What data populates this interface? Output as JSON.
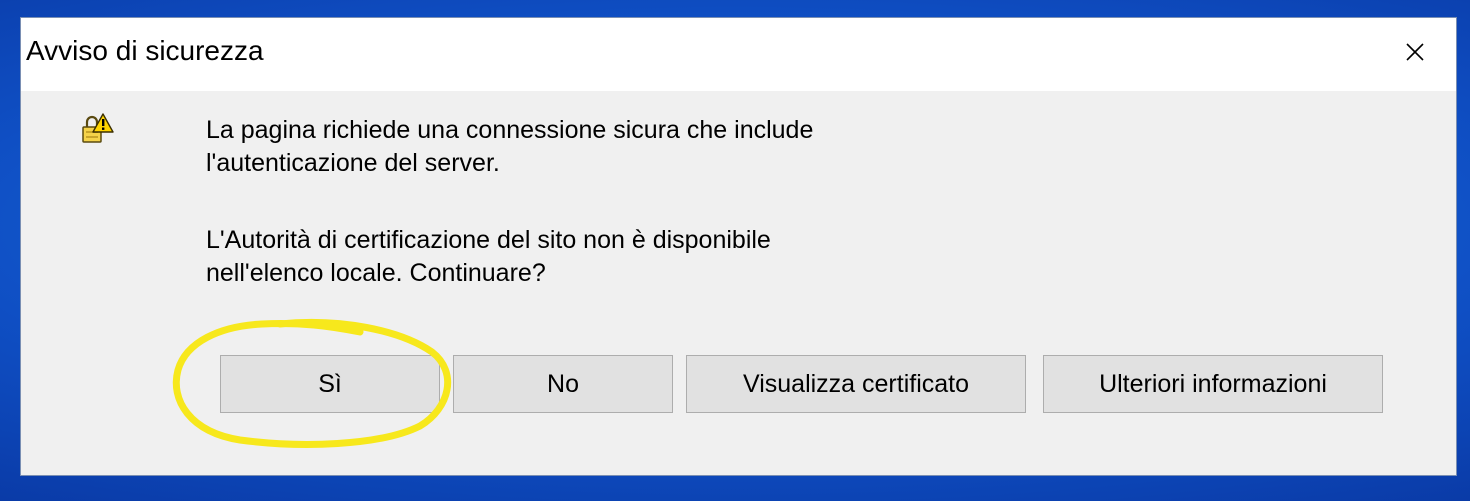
{
  "dialog": {
    "title": "Avviso di sicurezza",
    "close_glyph": "✕",
    "icon": "warning-lock-icon",
    "message_1": "La pagina richiede una connessione sicura che include\nl'autenticazione del server.",
    "message_2": "L'Autorità di certificazione del sito non è disponibile\nnell'elenco locale. Continuare?",
    "buttons": {
      "yes": "Sì",
      "no": "No",
      "view_certificate": "Visualizza certificato",
      "more_info": "Ulteriori informazioni"
    }
  },
  "annotation": {
    "color": "#f7e81c",
    "target": "yes-button"
  },
  "colors": {
    "dialog_bg": "#f0f0f0",
    "titlebar_bg": "#ffffff",
    "button_bg": "#e1e1e1",
    "button_border": "#adadad",
    "desktop_blue": "#0f4fc4"
  }
}
